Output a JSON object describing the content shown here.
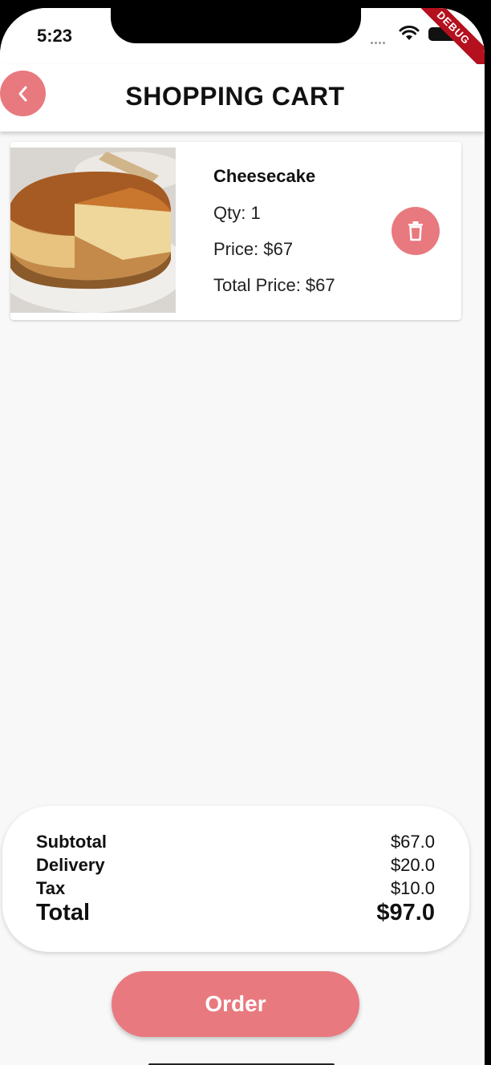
{
  "status_bar": {
    "time": "5:23",
    "debug_label": "DEBUG"
  },
  "app_bar": {
    "title": "SHOPPING CART",
    "back_icon": "chevron-left-icon"
  },
  "cart": {
    "items": [
      {
        "name": "Cheesecake",
        "qty": "Qty: 1",
        "price": "Price: $67",
        "total_price": "Total Price: $67",
        "image": "cheesecake-image",
        "delete_icon": "trash-icon"
      }
    ]
  },
  "summary": {
    "subtotal_label": "Subtotal",
    "subtotal_value": "$67.0",
    "delivery_label": "Delivery",
    "delivery_value": "$20.0",
    "tax_label": "Tax",
    "tax_value": "$10.0",
    "total_label": "Total",
    "total_value": "$97.0"
  },
  "order_button_label": "Order",
  "colors": {
    "accent": "#e8797f",
    "background": "#f8f8f8",
    "debug_ribbon": "#b4101e"
  }
}
